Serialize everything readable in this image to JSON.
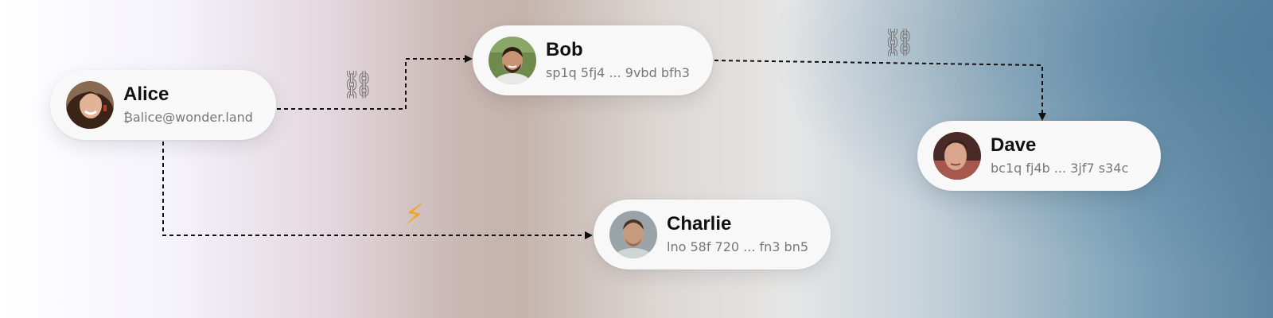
{
  "diagram": {
    "nodes": [
      {
        "id": "alice",
        "name": "Alice",
        "address": "₿alice@wonder.land"
      },
      {
        "id": "bob",
        "name": "Bob",
        "address": "sp1q 5fj4 ... 9vbd bfh3"
      },
      {
        "id": "charlie",
        "name": "Charlie",
        "address": "lno 58f 720 ... fn3 bn5"
      },
      {
        "id": "dave",
        "name": "Dave",
        "address": "bc1q fj4b ... 3jf7 s34c"
      }
    ],
    "edges": [
      {
        "from": "Alice",
        "to": "Bob",
        "icon": "chain-link-icon"
      },
      {
        "from": "Alice",
        "to": "Charlie",
        "icon": "lightning-bolt-icon"
      },
      {
        "from": "Bob",
        "to": "Dave",
        "icon": "chain-link-icon"
      }
    ],
    "icons": {
      "chain": "⛓",
      "bolt": "⚡"
    },
    "colors": {
      "bolt": "#f4a51c",
      "edge": "#111111",
      "node_bg": "#f8f8f8",
      "address_text": "#777777"
    }
  }
}
